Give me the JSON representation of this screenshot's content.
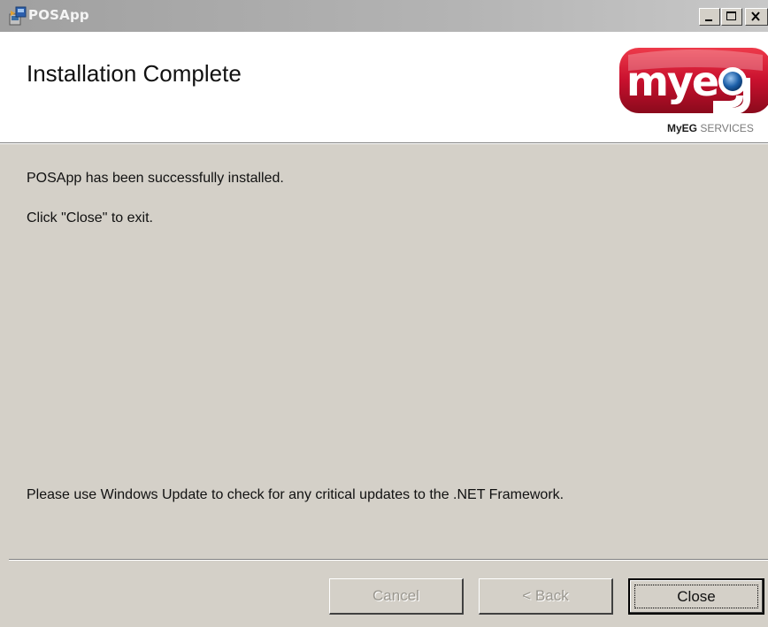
{
  "window": {
    "title": "POSApp",
    "controls": {
      "minimize": "minimize",
      "maximize": "maximize",
      "close": "close"
    }
  },
  "banner": {
    "title": "Installation Complete",
    "logo": {
      "brand": "myeg",
      "tagline_bold": "MyEG",
      "tagline_rest": " SERVICES"
    }
  },
  "body": {
    "line1": "POSApp has been successfully installed.",
    "line2": "Click \"Close\" to exit.",
    "line3": "Please use Windows Update to check for any critical updates to the .NET Framework."
  },
  "buttons": {
    "cancel": {
      "label": "Cancel",
      "enabled": false
    },
    "back": {
      "label": "< Back",
      "enabled": false
    },
    "close": {
      "label": "Close",
      "enabled": true,
      "default": true
    }
  },
  "colors": {
    "dialog_face": "#d4d0c8",
    "logo_red": "#c8102e",
    "logo_blue": "#1c5fa8"
  }
}
